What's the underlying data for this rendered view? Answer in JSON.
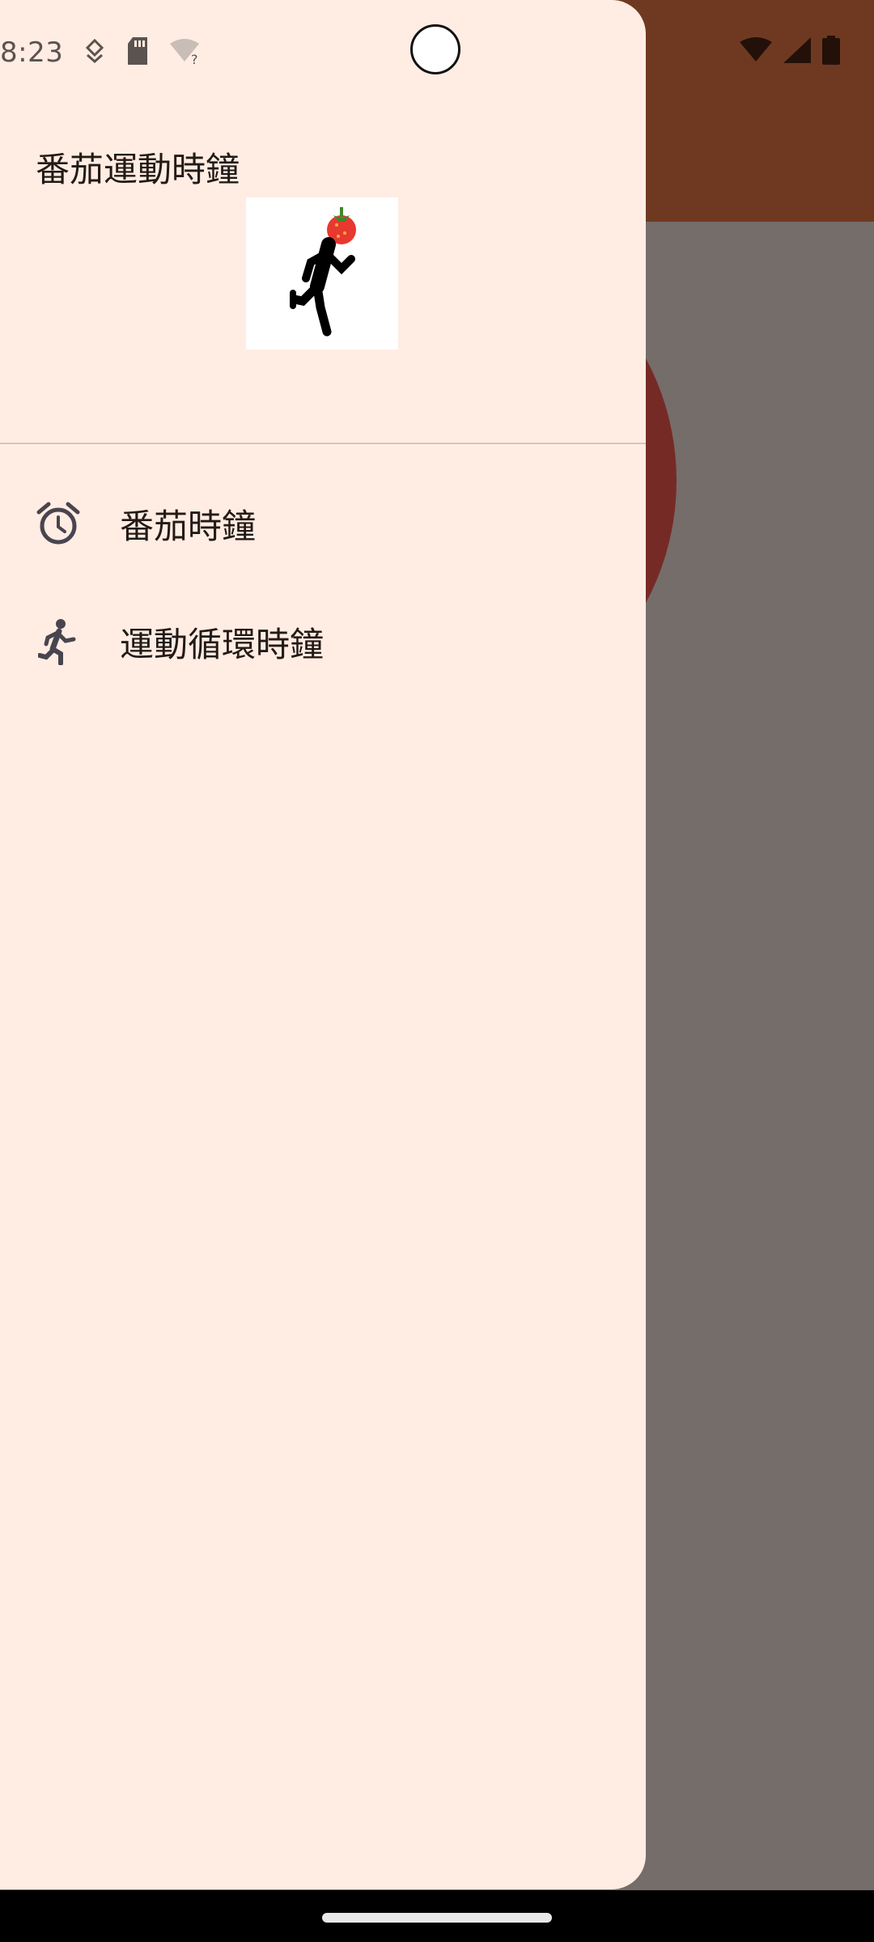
{
  "status_bar": {
    "time": "8:23"
  },
  "drawer": {
    "title": "番茄運動時鐘",
    "logo_icon": "running-tomato-icon",
    "items": [
      {
        "label": "番茄時鐘",
        "icon": "alarm-clock-icon"
      },
      {
        "label": "運動循環時鐘",
        "icon": "running-person-icon"
      }
    ]
  },
  "colors": {
    "drawer_bg": "#ffede3",
    "app_bar": "#6f3921",
    "scrim_content": "#756d6a",
    "circle": "#762a26",
    "text": "#231a16",
    "icon": "#49454f"
  }
}
